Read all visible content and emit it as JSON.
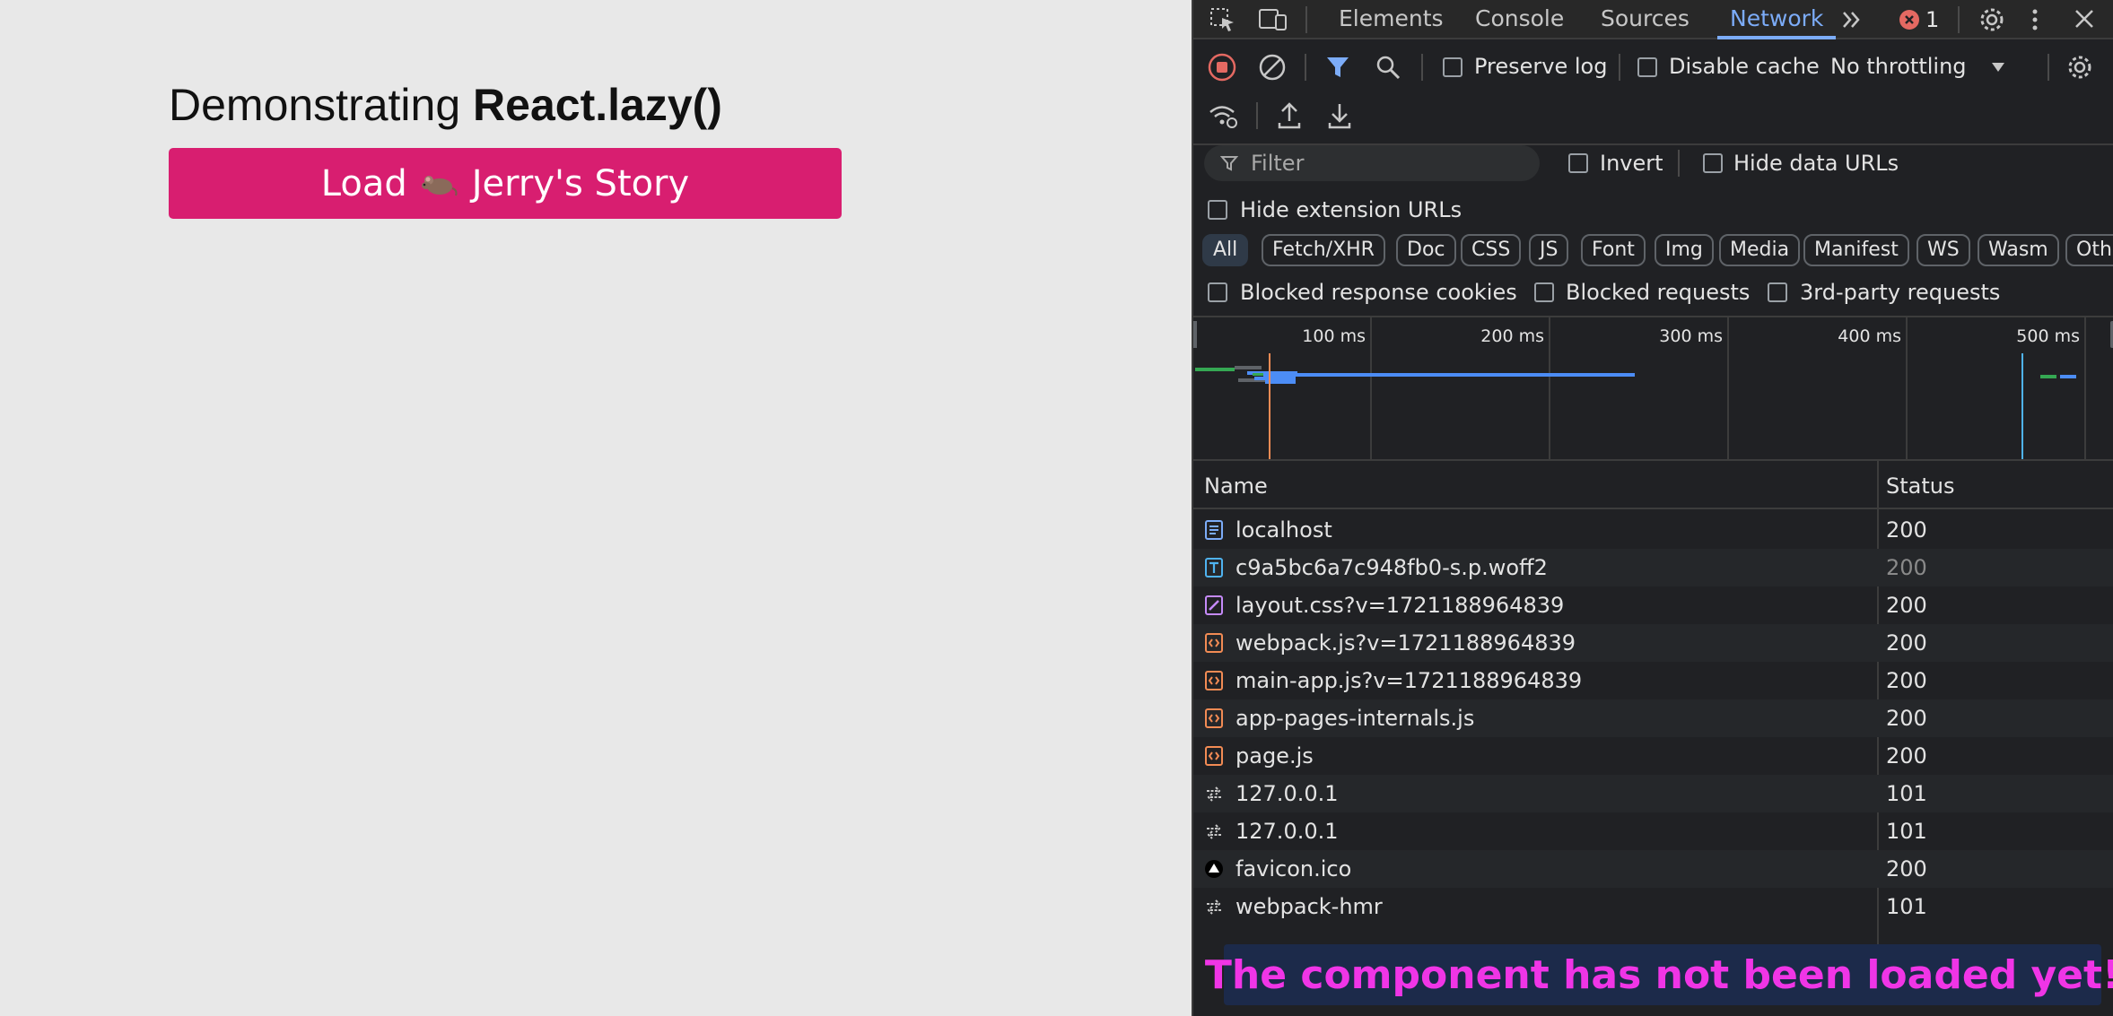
{
  "page": {
    "heading_prefix": "Demonstrating ",
    "heading_bold": "React.lazy()",
    "button_prefix": "Load",
    "button_suffix": "Jerry's Story",
    "button_color": "#d81e70"
  },
  "devtools": {
    "tabs": [
      {
        "label": "Elements",
        "active": false
      },
      {
        "label": "Console",
        "active": false
      },
      {
        "label": "Sources",
        "active": false
      },
      {
        "label": "Network",
        "active": true
      }
    ],
    "error_count": "1",
    "toolbar": {
      "preserve_log": "Preserve log",
      "disable_cache": "Disable cache",
      "throttling": "No throttling"
    },
    "filter": {
      "placeholder": "Filter",
      "invert": "Invert",
      "hide_data_urls": "Hide data URLs",
      "hide_extension_urls": "Hide extension URLs"
    },
    "types": [
      "All",
      "Fetch/XHR",
      "Doc",
      "CSS",
      "JS",
      "Font",
      "Img",
      "Media",
      "Manifest",
      "WS",
      "Wasm",
      "Othe"
    ],
    "blocked": {
      "cookies": "Blocked response cookies",
      "requests": "Blocked requests",
      "third_party": "3rd-party requests"
    },
    "timeline_ticks": [
      "100 ms",
      "200 ms",
      "300 ms",
      "400 ms",
      "500 ms"
    ],
    "table": {
      "col_name": "Name",
      "col_status": "Status",
      "rows": [
        {
          "name": "localhost",
          "status": "200",
          "icon": "document-icon"
        },
        {
          "name": "c9a5bc6a7c948fb0-s.p.woff2",
          "status": "200",
          "icon": "font-icon"
        },
        {
          "name": "layout.css?v=1721188964839",
          "status": "200",
          "icon": "stylesheet-icon"
        },
        {
          "name": "webpack.js?v=1721188964839",
          "status": "200",
          "icon": "script-icon"
        },
        {
          "name": "main-app.js?v=1721188964839",
          "status": "200",
          "icon": "script-icon"
        },
        {
          "name": "app-pages-internals.js",
          "status": "200",
          "icon": "script-icon"
        },
        {
          "name": "page.js",
          "status": "200",
          "icon": "script-icon"
        },
        {
          "name": "127.0.0.1",
          "status": "101",
          "icon": "websocket-icon"
        },
        {
          "name": "127.0.0.1",
          "status": "101",
          "icon": "websocket-icon"
        },
        {
          "name": "favicon.ico",
          "status": "200",
          "icon": "favicon-icon"
        },
        {
          "name": "webpack-hmr",
          "status": "101",
          "icon": "websocket-icon"
        }
      ]
    }
  },
  "banner": {
    "text": "The component has not been loaded yet!",
    "color": "#f035e6"
  }
}
